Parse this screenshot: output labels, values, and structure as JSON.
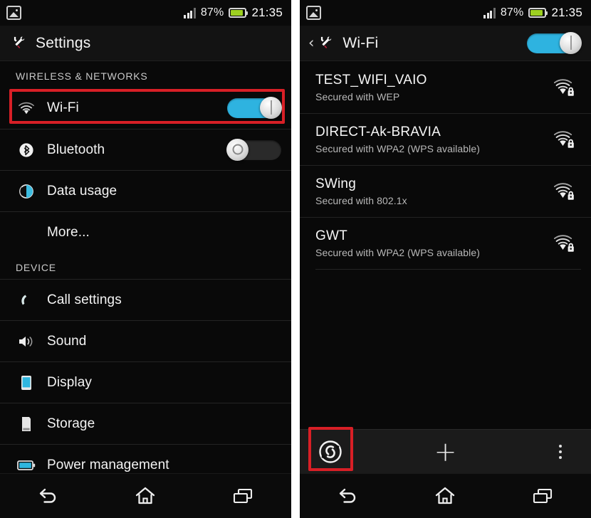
{
  "statusbar": {
    "gallery_icon": "gallery-icon",
    "signal_icon": "signal-bars-icon",
    "battery_percent": "87%",
    "battery_icon": "battery-icon",
    "battery_level": 87,
    "clock": "21:35"
  },
  "colors": {
    "accent_blue": "#2eb3e0",
    "highlight_red": "#d81f26",
    "battery_green": "#9dd021",
    "screen_bg": "#090909",
    "actionbar_bg": "#131313"
  },
  "left_screen": {
    "header": {
      "title": "Settings",
      "icon": "settings-tools-icon"
    },
    "sections": [
      {
        "label": "WIRELESS & NETWORKS",
        "rows": [
          {
            "label": "Wi-Fi",
            "icon": "wifi-icon",
            "toggle": "on",
            "highlighted": true
          },
          {
            "label": "Bluetooth",
            "icon": "bluetooth-icon",
            "toggle": "off",
            "highlighted": false
          },
          {
            "label": "Data usage",
            "icon": "data-usage-icon",
            "toggle": null,
            "highlighted": false
          },
          {
            "label": "More...",
            "icon": null,
            "toggle": null,
            "highlighted": false
          }
        ]
      },
      {
        "label": "DEVICE",
        "rows": [
          {
            "label": "Call settings",
            "icon": "phone-icon",
            "toggle": null,
            "highlighted": false
          },
          {
            "label": "Sound",
            "icon": "speaker-icon",
            "toggle": null,
            "highlighted": false
          },
          {
            "label": "Display",
            "icon": "display-icon",
            "toggle": null,
            "highlighted": false
          },
          {
            "label": "Storage",
            "icon": "storage-icon",
            "toggle": null,
            "highlighted": false
          },
          {
            "label": "Power management",
            "icon": "battery-icon",
            "toggle": null,
            "highlighted": false
          }
        ]
      }
    ],
    "navbar": {
      "back": "back-icon",
      "home": "home-icon",
      "recents": "recents-icon"
    }
  },
  "right_screen": {
    "header": {
      "back": "back-chevron-icon",
      "icon": "settings-tools-icon",
      "title": "Wi-Fi",
      "toggle": "on"
    },
    "networks": [
      {
        "ssid": "TEST_WIFI_VAIO",
        "security": "Secured with WEP",
        "icon": "wifi-signal-lock-icon"
      },
      {
        "ssid": "DIRECT-Ak-BRAVIA",
        "security": "Secured with WPA2 (WPS available)",
        "icon": "wifi-signal-lock-icon"
      },
      {
        "ssid": "SWing",
        "security": "Secured with 802.1x",
        "icon": "wifi-signal-lock-icon"
      },
      {
        "ssid": "GWT",
        "security": "Secured with WPA2 (WPS available)",
        "icon": "wifi-signal-lock-icon"
      }
    ],
    "bottombar": {
      "wps": "wps-icon",
      "add": "+",
      "overflow": "overflow-menu-icon",
      "wps_highlighted": true
    },
    "navbar": {
      "back": "back-icon",
      "home": "home-icon",
      "recents": "recents-icon"
    }
  }
}
